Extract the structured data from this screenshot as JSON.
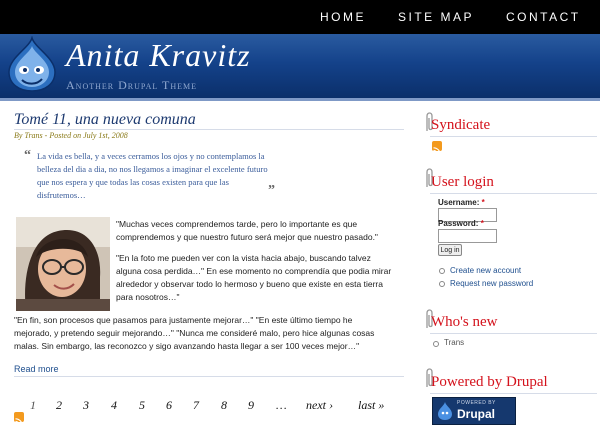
{
  "nav": {
    "home": "HOME",
    "sitemap": "SITE MAP",
    "contact": "CONTACT"
  },
  "header": {
    "site_name": "Anita Kravitz",
    "slogan": "Another Drupal Theme"
  },
  "post": {
    "title": "Tomé 11, una nueva comuna",
    "meta": "By Trans - Posted on July 1st, 2008",
    "quote_line1": "La vida es bella, y a veces cerramos los ojos y no contemplamos la",
    "quote_line2": "belleza del dia a dia, no nos llegamos a imaginar el excelente futuro",
    "quote_line3": "que nos espera y que todas las cosas existen para que las",
    "quote_line4": "disfrutemos…",
    "p1_line1": "\"Muchas veces comprendemos tarde, pero lo importante es que",
    "p1_line2": "comprendemos y que nuestro futuro será mejor que nuestro pasado.\"",
    "p2_line1": "\"En la foto me pueden ver con la vista hacia abajo, buscando talvez",
    "p2_line2": "alguna cosa perdida…\" En ese momento no comprendía que podia mirar",
    "p2_line3": "alrededor y observar todo lo hermoso y bueno que existe en esta tierra",
    "p2_line4": "para nosotros…\"",
    "p3_line1": "\"En fin, son procesos que pasamos para justamente mejorar…\" \"En este último tiempo he",
    "p3_line2": "mejorado, y pretendo seguir mejorando…\" \"Nunca me consideré malo, pero hice algunas cosas",
    "p3_line3": "malas. Sin embargo, las reconozco y sigo avanzando hasta llegar a ser 100 veces mejor…\"",
    "read_more": "Read more"
  },
  "pager": {
    "p1": "1",
    "p2": "2",
    "p3": "3",
    "p4": "4",
    "p5": "5",
    "p6": "6",
    "p7": "7",
    "p8": "8",
    "p9": "9",
    "ellipsis": "…",
    "next": "next ›",
    "last": "last »"
  },
  "sidebar": {
    "syndicate_title": "Syndicate",
    "login_title": "User login",
    "username_label": "Username:",
    "password_label": "Password:",
    "required_mark": "*",
    "login_button": "Log in",
    "create_account": "Create new account",
    "request_password": "Request new password",
    "whos_new_title": "Who's new",
    "whos_new_user": "Trans",
    "powered_title": "Powered by Drupal",
    "badge_small": "POWERED BY",
    "badge_big": "Drupal"
  },
  "colors": {
    "accent": "#d4121c",
    "header_blue": "#14428a",
    "link": "#1f4f8e"
  },
  "icons": [
    "drupal-drop-logo",
    "rss-feed-icon",
    "paperclip-icon"
  ]
}
